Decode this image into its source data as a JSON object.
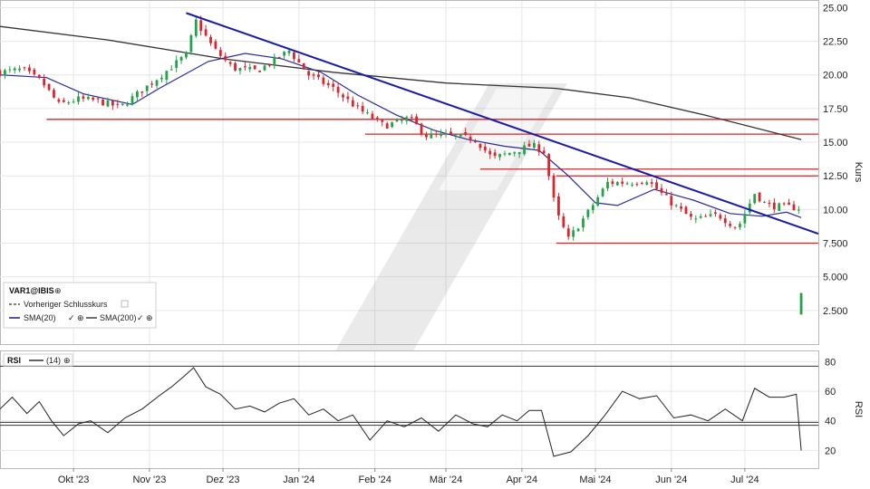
{
  "chart_data": [
    {
      "type": "candlestick",
      "symbol": "VAR1@IBIS",
      "ylabel": "Kurs",
      "ylim": [
        0,
        25.5
      ],
      "yticks": [
        "25.00",
        "22.50",
        "20.00",
        "17.50",
        "15.00",
        "12.50",
        "10.00",
        "7.500",
        "5.000",
        "2.500"
      ],
      "ytick_values": [
        25,
        22.5,
        20,
        17.5,
        15,
        12.5,
        10,
        7.5,
        5,
        2.5
      ],
      "xticks": [
        "Okt '23",
        "Nov '23",
        "Dez '23",
        "Jan '24",
        "Feb '24",
        "Mär '24",
        "Apr '24",
        "Mai '24",
        "Jun '24",
        "Jul '24"
      ],
      "xtick_dates": [
        "2023-10-01",
        "2023-11-01",
        "2023-12-01",
        "2024-01-01",
        "2024-02-01",
        "2024-03-01",
        "2024-04-01",
        "2024-05-01",
        "2024-06-01",
        "2024-07-01"
      ],
      "date_range": [
        "2023-09-01",
        "2024-07-31"
      ],
      "grid": true,
      "up_color": "#22a34a",
      "down_color": "#d6262e",
      "legend": {
        "placement": "bottom-left",
        "items": [
          {
            "label": "Vorheriger Schlusskurs",
            "style": "dashed",
            "color": "#333333"
          },
          {
            "label": "SMA(20)",
            "color": "#2a2a9a"
          },
          {
            "label": "SMA(200)",
            "color": "#333333"
          }
        ]
      },
      "close_path": [
        [
          "2023-09-01",
          20.2
        ],
        [
          "2023-09-10",
          20.4
        ],
        [
          "2023-09-18",
          19.5
        ],
        [
          "2023-09-25",
          17.8
        ],
        [
          "2023-10-03",
          18.2
        ],
        [
          "2023-10-10",
          18.1
        ],
        [
          "2023-10-20",
          17.6
        ],
        [
          "2023-10-30",
          19.0
        ],
        [
          "2023-11-08",
          20.3
        ],
        [
          "2023-11-16",
          21.5
        ],
        [
          "2023-11-20",
          24.0
        ],
        [
          "2023-11-27",
          22.0
        ],
        [
          "2023-12-05",
          20.5
        ],
        [
          "2023-12-15",
          20.3
        ],
        [
          "2023-12-28",
          21.8
        ],
        [
          "2024-01-05",
          20.0
        ],
        [
          "2024-01-15",
          19.0
        ],
        [
          "2024-01-25",
          17.5
        ],
        [
          "2024-02-05",
          16.2
        ],
        [
          "2024-02-15",
          16.8
        ],
        [
          "2024-02-22",
          15.5
        ],
        [
          "2024-03-04",
          15.5
        ],
        [
          "2024-03-13",
          15.2
        ],
        [
          "2024-03-20",
          13.8
        ],
        [
          "2024-04-01",
          14.5
        ],
        [
          "2024-04-05",
          14.8
        ],
        [
          "2024-04-10",
          14.3
        ],
        [
          "2024-04-15",
          9.8
        ],
        [
          "2024-04-20",
          7.8
        ],
        [
          "2024-04-28",
          9.8
        ],
        [
          "2024-05-06",
          12.0
        ],
        [
          "2024-05-15",
          12.0
        ],
        [
          "2024-05-22",
          12.2
        ],
        [
          "2024-06-01",
          10.5
        ],
        [
          "2024-06-10",
          9.2
        ],
        [
          "2024-06-20",
          9.6
        ],
        [
          "2024-06-28",
          8.6
        ],
        [
          "2024-07-05",
          11.2
        ],
        [
          "2024-07-10",
          10.3
        ],
        [
          "2024-07-18",
          10.2
        ],
        [
          "2024-07-23",
          10.1
        ],
        [
          "2024-07-24",
          2.6
        ]
      ],
      "sma20": [
        [
          "2023-09-01",
          20.0
        ],
        [
          "2023-09-20",
          19.8
        ],
        [
          "2023-10-05",
          18.6
        ],
        [
          "2023-10-25",
          17.8
        ],
        [
          "2023-11-05",
          19.0
        ],
        [
          "2023-11-25",
          21.0
        ],
        [
          "2023-12-10",
          21.6
        ],
        [
          "2023-12-25",
          21.2
        ],
        [
          "2024-01-10",
          20.2
        ],
        [
          "2024-01-25",
          18.5
        ],
        [
          "2024-02-10",
          17.0
        ],
        [
          "2024-02-25",
          15.9
        ],
        [
          "2024-03-10",
          15.2
        ],
        [
          "2024-03-25",
          14.7
        ],
        [
          "2024-04-08",
          14.4
        ],
        [
          "2024-04-20",
          12.5
        ],
        [
          "2024-05-01",
          10.5
        ],
        [
          "2024-05-10",
          10.3
        ],
        [
          "2024-05-25",
          11.5
        ],
        [
          "2024-06-10",
          10.7
        ],
        [
          "2024-06-25",
          9.7
        ],
        [
          "2024-07-08",
          9.5
        ],
        [
          "2024-07-18",
          9.8
        ],
        [
          "2024-07-24",
          9.4
        ]
      ],
      "sma200": [
        [
          "2023-09-01",
          23.6
        ],
        [
          "2023-10-15",
          22.6
        ],
        [
          "2023-12-01",
          21.2
        ],
        [
          "2024-01-15",
          20.2
        ],
        [
          "2024-03-01",
          19.4
        ],
        [
          "2024-04-15",
          19.0
        ],
        [
          "2024-05-15",
          18.3
        ],
        [
          "2024-06-15",
          17.0
        ],
        [
          "2024-07-24",
          15.2
        ]
      ],
      "annotations": {
        "trendline": {
          "color": "#1a1aa8",
          "points": [
            [
              "2023-11-16",
              24.6
            ],
            [
              "2024-07-31",
              8.2
            ]
          ]
        },
        "horizontal_levels": [
          {
            "value": 16.7,
            "from": "2023-09-20",
            "to": "2024-07-31",
            "color": "#e02020"
          },
          {
            "value": 15.6,
            "from": "2024-01-28",
            "to": "2024-07-31",
            "color": "#e02020"
          },
          {
            "value": 13.0,
            "from": "2024-03-15",
            "to": "2024-07-31",
            "color": "#e02020"
          },
          {
            "value": 12.5,
            "from": "2024-04-15",
            "to": "2024-07-31",
            "color": "#e02020"
          },
          {
            "value": 7.5,
            "from": "2024-04-15",
            "to": "2024-07-31",
            "color": "#e02020"
          }
        ]
      }
    },
    {
      "type": "line",
      "name": "RSI",
      "legend_label": "(14)",
      "ylabel": "RSI",
      "ylim": [
        8,
        87
      ],
      "yticks": [
        "80",
        "60",
        "40",
        "20"
      ],
      "ytick_values": [
        80,
        60,
        40,
        20
      ],
      "reference_lines": [
        77,
        39,
        37
      ],
      "line_color": "#222222",
      "points": [
        [
          "2023-09-01",
          48
        ],
        [
          "2023-09-06",
          56
        ],
        [
          "2023-09-12",
          45
        ],
        [
          "2023-09-17",
          53
        ],
        [
          "2023-09-22",
          40
        ],
        [
          "2023-09-27",
          30
        ],
        [
          "2023-10-03",
          38
        ],
        [
          "2023-10-08",
          40
        ],
        [
          "2023-10-15",
          32
        ],
        [
          "2023-10-22",
          42
        ],
        [
          "2023-10-29",
          48
        ],
        [
          "2023-11-05",
          57
        ],
        [
          "2023-11-10",
          63
        ],
        [
          "2023-11-15",
          70
        ],
        [
          "2023-11-19",
          76
        ],
        [
          "2023-11-24",
          63
        ],
        [
          "2023-11-30",
          58
        ],
        [
          "2023-12-06",
          48
        ],
        [
          "2023-12-12",
          50
        ],
        [
          "2023-12-18",
          46
        ],
        [
          "2023-12-24",
          52
        ],
        [
          "2023-12-30",
          55
        ],
        [
          "2024-01-05",
          44
        ],
        [
          "2024-01-11",
          48
        ],
        [
          "2024-01-17",
          40
        ],
        [
          "2024-01-23",
          44
        ],
        [
          "2024-01-30",
          27
        ],
        [
          "2024-02-06",
          40
        ],
        [
          "2024-02-13",
          36
        ],
        [
          "2024-02-20",
          42
        ],
        [
          "2024-02-27",
          33
        ],
        [
          "2024-03-05",
          44
        ],
        [
          "2024-03-12",
          38
        ],
        [
          "2024-03-18",
          36
        ],
        [
          "2024-03-24",
          44
        ],
        [
          "2024-03-30",
          40
        ],
        [
          "2024-04-04",
          47
        ],
        [
          "2024-04-09",
          47
        ],
        [
          "2024-04-14",
          16
        ],
        [
          "2024-04-21",
          19
        ],
        [
          "2024-04-28",
          30
        ],
        [
          "2024-05-05",
          44
        ],
        [
          "2024-05-12",
          60
        ],
        [
          "2024-05-19",
          55
        ],
        [
          "2024-05-26",
          57
        ],
        [
          "2024-06-02",
          42
        ],
        [
          "2024-06-09",
          44
        ],
        [
          "2024-06-16",
          40
        ],
        [
          "2024-06-23",
          48
        ],
        [
          "2024-06-30",
          40
        ],
        [
          "2024-07-05",
          62
        ],
        [
          "2024-07-11",
          56
        ],
        [
          "2024-07-17",
          56
        ],
        [
          "2024-07-22",
          58
        ],
        [
          "2024-07-24",
          20
        ]
      ]
    }
  ]
}
